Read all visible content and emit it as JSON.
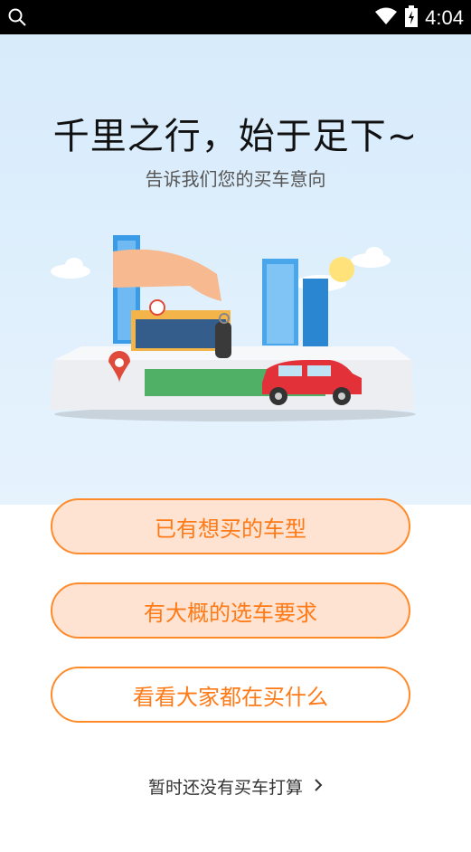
{
  "status": {
    "time": "4:04"
  },
  "header": {
    "title": "千里之行，始于足下~",
    "subtitle": "告诉我们您的买车意向"
  },
  "options": [
    {
      "label": "已有想买的车型"
    },
    {
      "label": "有大概的选车要求"
    },
    {
      "label": "看看大家都在买什么"
    }
  ],
  "skip": {
    "label": "暂时还没有买车打算"
  },
  "colors": {
    "accent": "#ff7a16",
    "button_fill": "#ffe3d2",
    "sky": "#d7ebfb"
  }
}
